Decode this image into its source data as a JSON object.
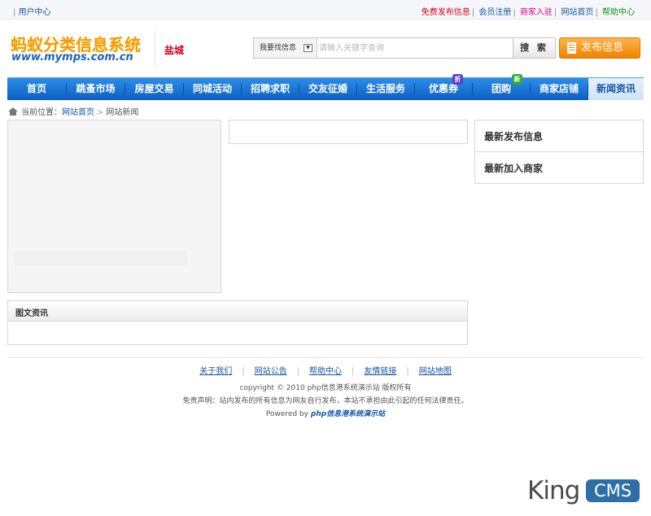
{
  "topbar": {
    "user_center": "用户中心",
    "links": [
      {
        "label": "免费发布信息",
        "color": "#d8001a"
      },
      {
        "label": "会员注册",
        "color": "#1a55a6"
      },
      {
        "label": "商家入驻",
        "color": "#d4008a"
      },
      {
        "label": "网站首页",
        "color": "#1a55a6"
      },
      {
        "label": "帮助中心",
        "color": "#1b8a1b"
      }
    ]
  },
  "header": {
    "logo_title": "蚂蚁分类信息系统",
    "logo_domain": "www.mymps.com.cn",
    "city": "盐城",
    "search": {
      "scope": "我要找信息",
      "placeholder": "请输入关键字查询",
      "button": "搜 索"
    },
    "post_button": "发布信息"
  },
  "nav": {
    "items": [
      {
        "label": "首页"
      },
      {
        "label": "跳蚤市场"
      },
      {
        "label": "房屋交易"
      },
      {
        "label": "同城活动"
      },
      {
        "label": "招聘求职"
      },
      {
        "label": "交友征婚"
      },
      {
        "label": "生活服务"
      },
      {
        "label": "优惠券",
        "badge": "折"
      },
      {
        "label": "团购",
        "badge": "新"
      },
      {
        "label": "商家店铺"
      },
      {
        "label": "新闻资讯",
        "active": true
      }
    ]
  },
  "breadcrumb": {
    "prefix": "当前位置：",
    "home": "网站首页",
    "current": "网站新闻"
  },
  "sidebar": {
    "latest_posts": "最新发布信息",
    "latest_merchants": "最新加入商家"
  },
  "tuwen": {
    "title": "图文资讯"
  },
  "footer": {
    "links": [
      "关于我们",
      "网站公告",
      "帮助中心",
      "友情链接",
      "网站地图"
    ],
    "copyright": "copyright © 2010 php信息港系统演示站  版权所有",
    "disclaimer": "免责声明：站内发布的所有信息为网友自行发布，本站不承担由此引起的任何法律责任。",
    "powered_prefix": "Powered by",
    "powered_name": "php信息港系统演示站"
  },
  "watermark": {
    "text1": "King",
    "text2": "CMS"
  },
  "colors": {
    "nav_blue": "#0c5fc5",
    "post_orange": "#f08200",
    "link_blue": "#1a55a6",
    "city_red": "#d8001a"
  }
}
